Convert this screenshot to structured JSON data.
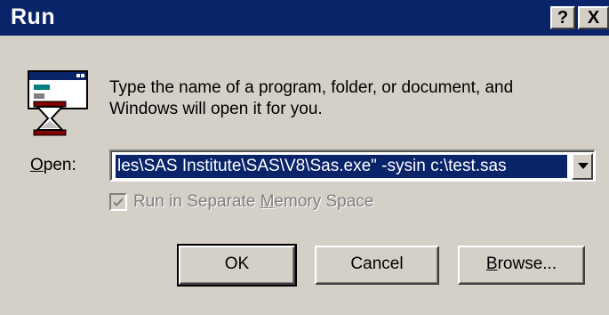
{
  "window": {
    "title": "Run",
    "help_glyph": "?",
    "close_glyph": "X"
  },
  "icon": "run-program-icon",
  "message": {
    "line1": "Type the name of a program, folder, or document, and",
    "line2": "Windows will open it for you."
  },
  "open_field": {
    "label_prefix": "O",
    "label_rest": "pen:",
    "value": "les\\SAS Institute\\SAS\\V8\\Sas.exe\" -sysin c:\\test.sas"
  },
  "checkbox": {
    "label_before": "Run in Separate ",
    "label_mnemonic": "M",
    "label_after": "emory Space",
    "checked": true,
    "enabled": false
  },
  "buttons": {
    "ok_label": "OK",
    "cancel_label": "Cancel",
    "browse_prefix": "B",
    "browse_rest": "rowse..."
  },
  "colors": {
    "titlebar": "#0a246a",
    "face": "#d4d0c8",
    "selection": "#0a246a"
  }
}
